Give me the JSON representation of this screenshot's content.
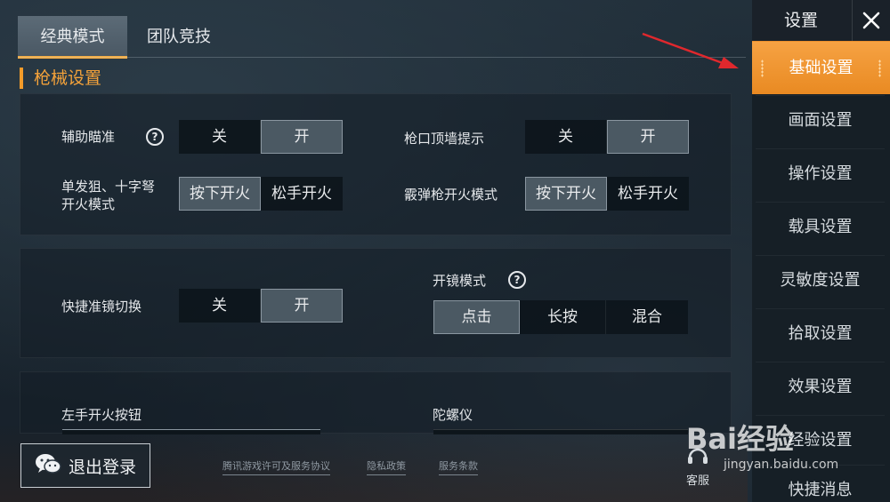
{
  "top_tabs": [
    "经典模式",
    "团队竞技"
  ],
  "section_title": "枪械设置",
  "panel1": {
    "aim_assist": {
      "label": "辅助瞄准",
      "options": [
        "关",
        "开"
      ],
      "selected": "开"
    },
    "muzzle_wall": {
      "label": "枪口顶墙提示",
      "options": [
        "关",
        "开"
      ],
      "selected": "开"
    },
    "sniper_fire": {
      "label_line1": "单发狙、十字弩",
      "label_line2": "开火模式",
      "options": [
        "按下开火",
        "松手开火"
      ],
      "selected": "按下开火"
    },
    "shotgun_fire": {
      "label": "霰弹枪开火模式",
      "options": [
        "按下开火",
        "松手开火"
      ],
      "selected": "按下开火"
    }
  },
  "panel2": {
    "quick_scope": {
      "label": "快捷准镜切换",
      "options": [
        "关",
        "开"
      ],
      "selected": "开"
    },
    "scope_mode": {
      "label": "开镜模式",
      "options": [
        "点击",
        "长按",
        "混合"
      ],
      "selected": "点击"
    }
  },
  "panel3": {
    "left_fire": {
      "label": "左手开火按钮"
    },
    "gyroscope": {
      "label": "陀螺仪"
    }
  },
  "footer": {
    "logout": "退出登录",
    "links": [
      "腾讯游戏许可及服务协议",
      "隐私政策",
      "服务条款"
    ],
    "support": "客服"
  },
  "sidebar": {
    "title": "设置",
    "items": [
      "基础设置",
      "画面设置",
      "操作设置",
      "载具设置",
      "灵敏度设置",
      "拾取设置",
      "效果设置",
      "经验设置",
      "快捷消息"
    ],
    "active": "基础设置"
  },
  "watermark": {
    "brand": "Bai经验",
    "url": "jingyan.baidu.com"
  },
  "colors": {
    "accent": "#f39b2a",
    "selected_bg": "#4b5963",
    "sidebar_active": "#ee9330",
    "arrow": "#e0282d"
  },
  "icons": [
    "help-circle-icon",
    "close-icon",
    "wechat-icon",
    "headset-icon"
  ]
}
